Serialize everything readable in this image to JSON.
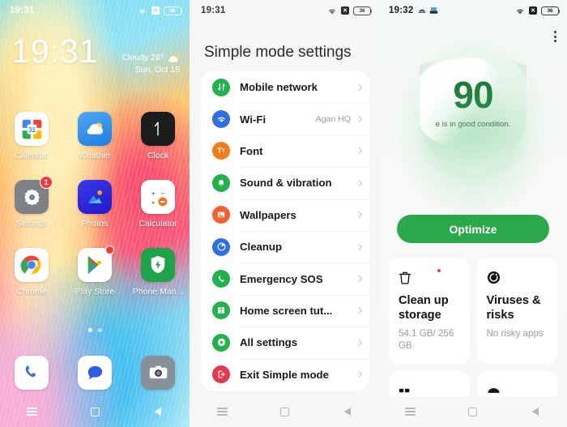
{
  "home": {
    "status": {
      "time": "19:31",
      "wifi_icon": "wifi-icon",
      "dnd_icon": "dnd-icon",
      "battery": "36"
    },
    "clock": "19:31",
    "weather": {
      "condition": "Cloudy 28°",
      "date": "Sun, Oct 15",
      "icon": "partly-cloudy-icon"
    },
    "apps": [
      {
        "label": "Calendar",
        "icon": "calendar-icon",
        "badge": ""
      },
      {
        "label": "Weather",
        "icon": "weather-icon",
        "badge": ""
      },
      {
        "label": "Clock",
        "icon": "clock-icon",
        "badge": ""
      },
      {
        "label": "Settings",
        "icon": "settings-icon",
        "badge": "1"
      },
      {
        "label": "Photos",
        "icon": "photos-icon",
        "badge": ""
      },
      {
        "label": "Calculator",
        "icon": "calculator-icon",
        "badge": ""
      },
      {
        "label": "Chrome",
        "icon": "chrome-icon",
        "badge": ""
      },
      {
        "label": "Play Store",
        "icon": "play-store-icon",
        "badge": "dot"
      },
      {
        "label": "Phone Man...",
        "icon": "phone-manager-icon",
        "badge": ""
      }
    ],
    "dock": [
      {
        "label": "Phone",
        "icon": "phone-icon"
      },
      {
        "label": "Messages",
        "icon": "messages-icon"
      },
      {
        "label": "Camera",
        "icon": "camera-icon"
      }
    ],
    "page_dots": {
      "count": 2,
      "active": 0
    }
  },
  "settings": {
    "status": {
      "time": "19:31",
      "battery": "36"
    },
    "title": "Simple mode settings",
    "items": [
      {
        "label": "Mobile network",
        "value": "",
        "icon": "mobile-network-icon",
        "color": "#22b14c"
      },
      {
        "label": "Wi-Fi",
        "value": "Agan HQ",
        "icon": "wifi-icon",
        "color": "#2f6fe0"
      },
      {
        "label": "Font",
        "value": "",
        "icon": "font-icon",
        "color": "#f07c1e"
      },
      {
        "label": "Sound & vibration",
        "value": "",
        "icon": "sound-vibration-icon",
        "color": "#22b14c"
      },
      {
        "label": "Wallpapers",
        "value": "",
        "icon": "wallpapers-icon",
        "color": "#f4602f"
      },
      {
        "label": "Cleanup",
        "value": "",
        "icon": "cleanup-icon",
        "color": "#2f6fe0"
      },
      {
        "label": "Emergency SOS",
        "value": "",
        "icon": "emergency-sos-icon",
        "color": "#22b14c"
      },
      {
        "label": "Home screen tut...",
        "value": "",
        "icon": "home-screen-tutorial-icon",
        "color": "#22b14c"
      },
      {
        "label": "All settings",
        "value": "",
        "icon": "all-settings-icon",
        "color": "#22b14c"
      },
      {
        "label": "Exit Simple mode",
        "value": "",
        "icon": "exit-simple-mode-icon",
        "color": "#e8384f"
      }
    ]
  },
  "manager": {
    "status": {
      "time": "19:32",
      "battery": "36"
    },
    "score": "90",
    "score_caption": "e is in good condition.",
    "optimize_label": "Optimize",
    "cards": [
      {
        "title": "Clean up storage",
        "subtitle": "54.1 GB/ 256 GB",
        "icon": "trash-icon",
        "dot": true
      },
      {
        "title": "Viruses & risks",
        "subtitle": "No risky apps",
        "icon": "virus-scan-icon",
        "dot": false
      },
      {
        "title": "",
        "subtitle": "",
        "icon": "apps-icon",
        "dot": false
      },
      {
        "title": "",
        "subtitle": "",
        "icon": "cloud-icon",
        "dot": false
      }
    ]
  },
  "navbar": {
    "recent": "recent-apps-button",
    "home": "home-button",
    "back": "back-button"
  },
  "colors": {
    "accent_green": "#2ba84a",
    "score_green": "#1e7a38",
    "badge_red": "#f4393c"
  }
}
